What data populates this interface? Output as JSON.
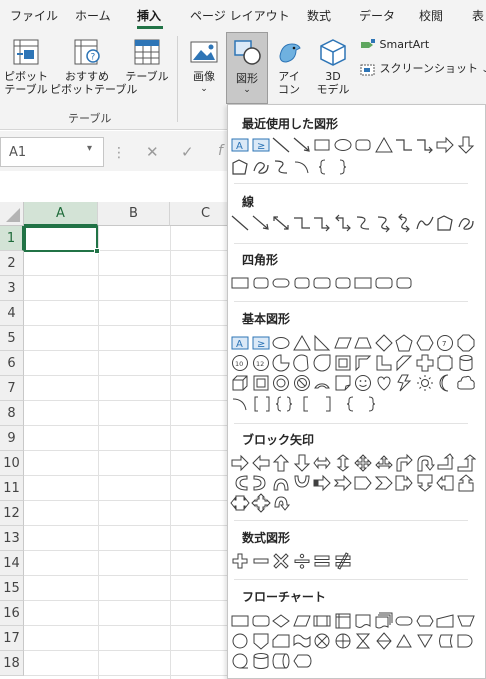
{
  "ribbon_tabs": [
    "ファイル",
    "ホーム",
    "挿入",
    "ページ レイアウト",
    "数式",
    "データ",
    "校閲",
    "表"
  ],
  "active_tab": "挿入",
  "ribbon": {
    "pivot_table": "ピボット\nテーブル",
    "recommended_pivot": "おすすめ\nピボットテーブル",
    "table": "テーブル",
    "tables_group": "テーブル",
    "images": "画像",
    "shapes": "図形",
    "icons": "アイ\nコン",
    "models_3d": "3D\nモデル",
    "smartart": "SmartArt",
    "screenshot": "スクリーンショット"
  },
  "formula_bar": {
    "name_box": "A1"
  },
  "sheet": {
    "columns": [
      "A",
      "B",
      "C"
    ],
    "rows": [
      "1",
      "2",
      "3",
      "4",
      "5",
      "6",
      "7",
      "8",
      "9",
      "10",
      "11",
      "12",
      "13",
      "14",
      "15",
      "16",
      "17",
      "18"
    ],
    "active_cell": "A1"
  },
  "gallery": {
    "sections": [
      "最近使用した図形",
      "線",
      "四角形",
      "基本図形",
      "ブロック矢印",
      "数式図形",
      "フローチャート"
    ]
  },
  "colors": {
    "accent": "#217346",
    "ribbon_bg": "#f3f3f3",
    "icon_blue": "#2e75b6",
    "shape_stroke": "#404040"
  }
}
